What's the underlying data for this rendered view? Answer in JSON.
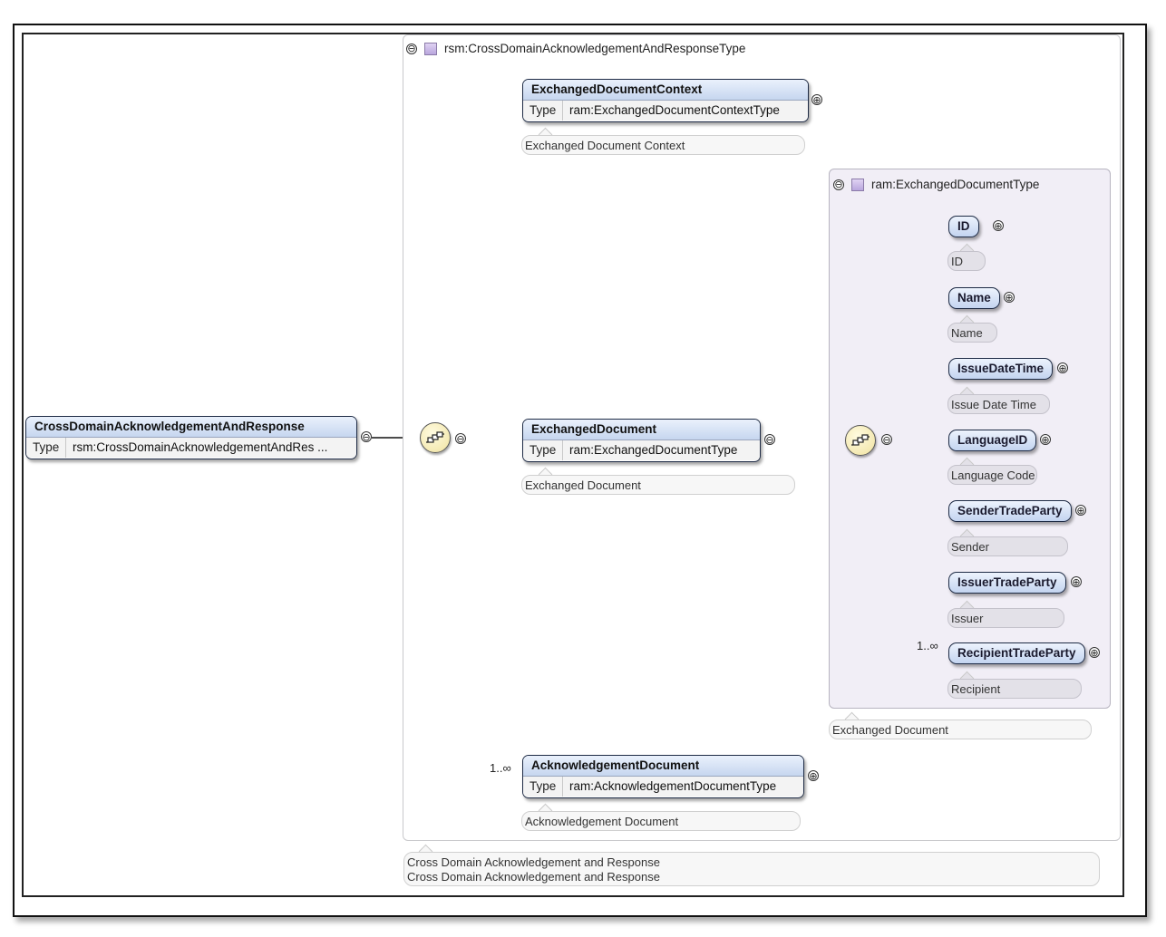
{
  "root": {
    "name": "CrossDomainAcknowledgementAndResponse",
    "type_label": "Type",
    "type_value": "rsm:CrossDomainAcknowledgementAndRes ...",
    "annotation_line1": "Cross Domain Acknowledgement and Response",
    "annotation_line2": "Cross Domain Acknowledgement and Response"
  },
  "complex_type": {
    "name": "rsm:CrossDomainAcknowledgementAndResponseType",
    "children": {
      "context": {
        "name": "ExchangedDocumentContext",
        "type_label": "Type",
        "type_value": "ram:ExchangedDocumentContextType",
        "annotation": "Exchanged Document Context"
      },
      "document": {
        "name": "ExchangedDocument",
        "type_label": "Type",
        "type_value": "ram:ExchangedDocumentType",
        "annotation": "Exchanged Document"
      },
      "ack": {
        "name": "AcknowledgementDocument",
        "type_label": "Type",
        "type_value": "ram:AcknowledgementDocumentType",
        "annotation": "Acknowledgement Document",
        "cardinality": "1..∞"
      }
    }
  },
  "exchanged_type": {
    "name": "ram:ExchangedDocumentType",
    "outer_annotation": "Exchanged Document",
    "items": [
      {
        "name": "ID",
        "annotation": "ID"
      },
      {
        "name": "Name",
        "annotation": "Name"
      },
      {
        "name": "IssueDateTime",
        "annotation": "Issue Date Time"
      },
      {
        "name": "LanguageID",
        "annotation": "Language Code"
      },
      {
        "name": "SenderTradeParty",
        "annotation": "Sender"
      },
      {
        "name": "IssuerTradeParty",
        "annotation": "Issuer"
      },
      {
        "name": "RecipientTradeParty",
        "annotation": "Recipient",
        "cardinality": "1..∞"
      }
    ]
  },
  "symbols": {
    "collapse": "⊖",
    "expand": "⊕"
  },
  "colors": {
    "pill_top": "#edf3fd",
    "pill_bottom": "#c3d4f0",
    "type_box": "#f1eef6",
    "sequence": "#f0e2a0"
  }
}
